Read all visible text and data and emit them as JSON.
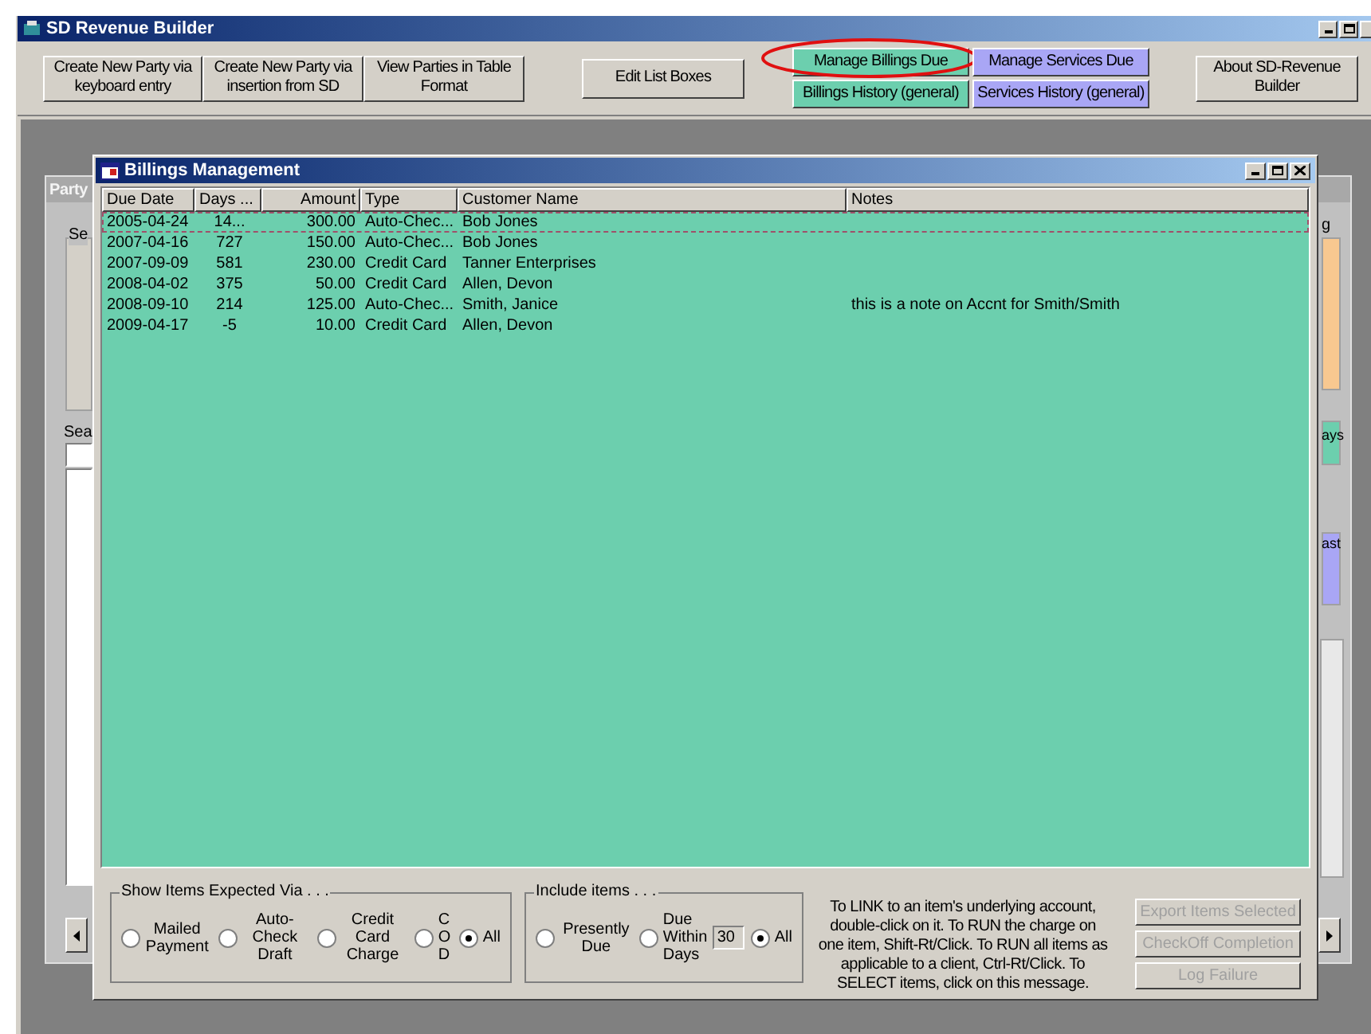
{
  "app_window": {
    "title": "SD Revenue Builder"
  },
  "toolbar": [
    {
      "label": "Create New Party via keyboard entry",
      "color": "#d4d0c8",
      "circled": false
    },
    {
      "label": "Create New Party via insertion from SD",
      "color": "#d4d0c8",
      "circled": false
    },
    {
      "label": "View Parties in Table Format",
      "color": "#d4d0c8",
      "circled": false
    },
    {
      "label": "Edit List Boxes",
      "color": "#d4d0c8",
      "circled": false
    },
    {
      "label": "Manage Billings Due",
      "color": "#6ccfae",
      "circled": true
    },
    {
      "label": "Manage Services Due",
      "color": "#a9a6f5",
      "circled": false
    },
    {
      "label": "About SD-Revenue Builder",
      "color": "#d4d0c8",
      "circled": false
    },
    {
      "label": "Billings History (general)",
      "color": "#6ccfae",
      "circled": false
    },
    {
      "label": "Services History (general)",
      "color": "#a9a6f5",
      "circled": false
    }
  ],
  "background_window": {
    "title": "Party",
    "group_label": "Se",
    "search_label": "Sea",
    "right_labels": [
      "g",
      "ays",
      "ast"
    ]
  },
  "billings_window": {
    "title": "Billings Management",
    "columns": [
      "Due Date",
      "Days ...",
      "Amount",
      "Type",
      "Customer Name",
      "Notes"
    ],
    "rows": [
      {
        "cells": [
          "2005-04-24",
          "14...",
          "300.00",
          "Auto-Chec...",
          "Bob Jones",
          ""
        ],
        "selected": true
      },
      {
        "cells": [
          "2007-04-16",
          "727",
          "150.00",
          "Auto-Chec...",
          "Bob Jones",
          ""
        ],
        "selected": false
      },
      {
        "cells": [
          "2007-09-09",
          "581",
          "230.00",
          "Credit Card",
          "Tanner Enterprises",
          ""
        ],
        "selected": false
      },
      {
        "cells": [
          "2008-04-02",
          "375",
          "50.00",
          "Credit Card",
          "Allen, Devon",
          ""
        ],
        "selected": false
      },
      {
        "cells": [
          "2008-09-10",
          "214",
          "125.00",
          "Auto-Chec...",
          "Smith, Janice",
          "this is a note on Accnt for Smith/Smith"
        ],
        "selected": false
      },
      {
        "cells": [
          "2009-04-17",
          "-5",
          "10.00",
          "Credit Card",
          "Allen, Devon",
          ""
        ],
        "selected": false
      }
    ],
    "filter_groups": [
      {
        "title": "Show Items Expected Via . . .",
        "options": [
          {
            "kind": "text",
            "label": "Mailed Payment",
            "selected": false
          },
          {
            "kind": "text",
            "label": "Auto-Check Draft",
            "selected": false
          },
          {
            "kind": "text",
            "label": "Credit Card Charge",
            "selected": false
          },
          {
            "kind": "vertical",
            "label": "C O D",
            "selected": false
          },
          {
            "kind": "text",
            "label": "All",
            "selected": true
          }
        ]
      },
      {
        "title": "Include items . . .",
        "options": [
          {
            "kind": "text",
            "label": "Presently Due",
            "selected": false
          },
          {
            "kind": "days",
            "label": "Due Within",
            "value": "30",
            "label_after": "Days",
            "selected": false
          },
          {
            "kind": "text",
            "label": "All",
            "selected": true
          }
        ]
      }
    ],
    "help_text": "To LINK to an item's underlying account, double-click on it.  To RUN the charge on one item, Shift-Rt/Click.  To RUN all items as applicable to a client, Ctrl-Rt/Click.  To SELECT items, click on this message.",
    "buttons": [
      {
        "label": "Export Items Selected",
        "disabled": true
      },
      {
        "label": "CheckOff Completion",
        "disabled": true
      },
      {
        "label": "Log Failure",
        "disabled": true
      }
    ]
  }
}
